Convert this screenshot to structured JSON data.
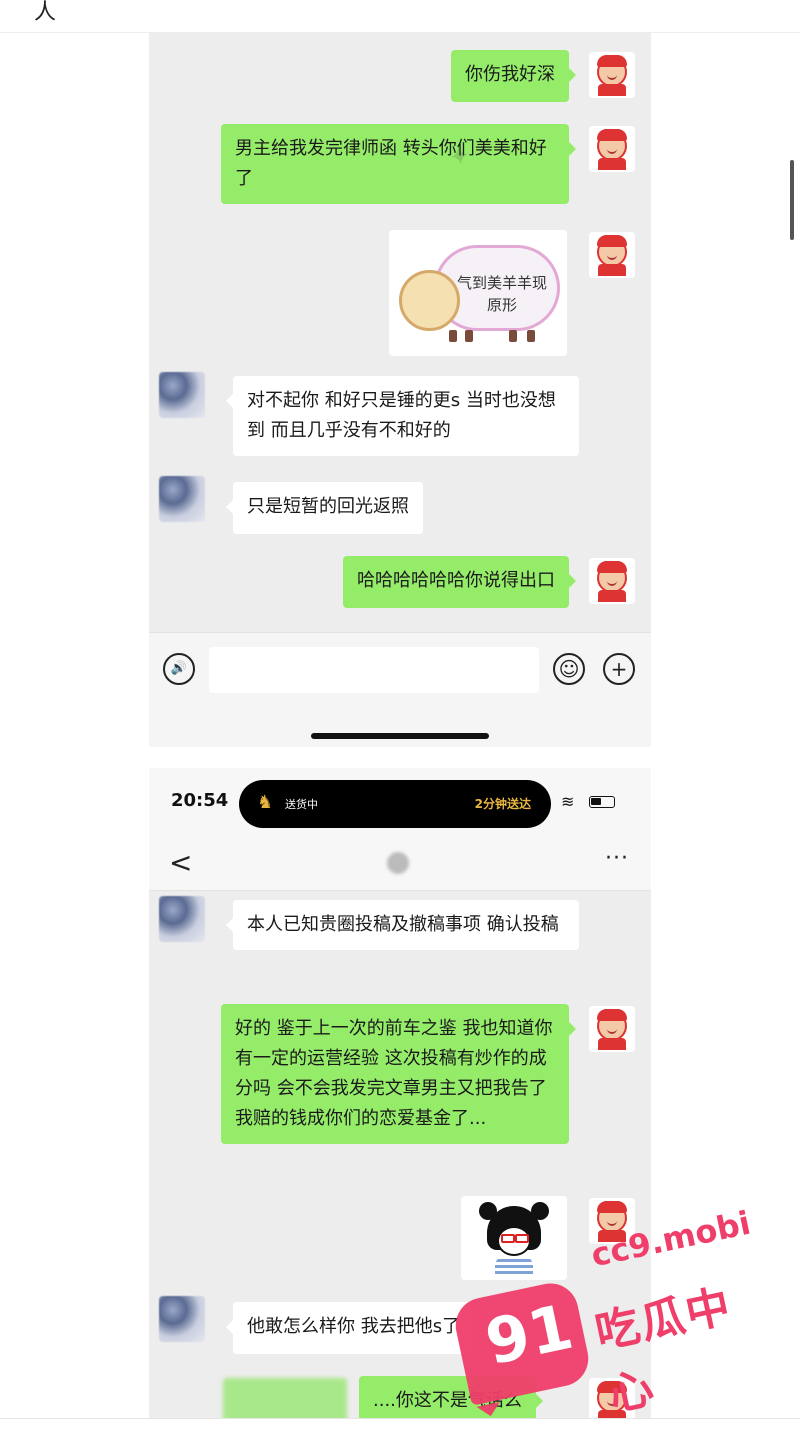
{
  "top_glyph": "人",
  "screenshot1": {
    "messages": [
      {
        "side": "me",
        "text": "你伤我好深"
      },
      {
        "side": "me",
        "text": "男主给我发完律师函 转头你们美美和好了"
      },
      {
        "side": "me",
        "sticker_text": "气到美羊羊现原形"
      },
      {
        "side": "them",
        "text": "对不起你 和好只是锤的更s 当时也没想到 而且几乎没有不和好的"
      },
      {
        "side": "them",
        "text": "只是短暂的回光返照"
      },
      {
        "side": "me",
        "text": "哈哈哈哈哈哈你说得出口"
      }
    ],
    "input": {
      "voice_icon": "🔊",
      "emoji_icon": "☺",
      "plus_icon": "+"
    }
  },
  "screenshot2": {
    "status_bar": {
      "time": "20:54",
      "island_left": "送货中",
      "island_right": "2分钟送达",
      "wifi_icon": "≋"
    },
    "nav": {
      "back": "<",
      "more": "···"
    },
    "messages": [
      {
        "side": "them",
        "text": "本人已知贵圈投稿及撤稿事项 确认投稿"
      },
      {
        "side": "me",
        "text": "好的 鉴于上一次的前车之鉴 我也知道你有一定的运营经验 这次投稿有炒作的成分吗 会不会我发完文章男主又把我告了 我赔的钱成你们的恋爱基金了..."
      },
      {
        "side": "me",
        "sticker": "girl-glasses"
      },
      {
        "side": "them",
        "text": "他敢怎么样你 我去把他s了"
      },
      {
        "side": "me",
        "text": "....你这不是气话么"
      }
    ]
  },
  "watermark": {
    "badge": "91",
    "url": "cc9.mobi",
    "label": "吃瓜中心"
  }
}
